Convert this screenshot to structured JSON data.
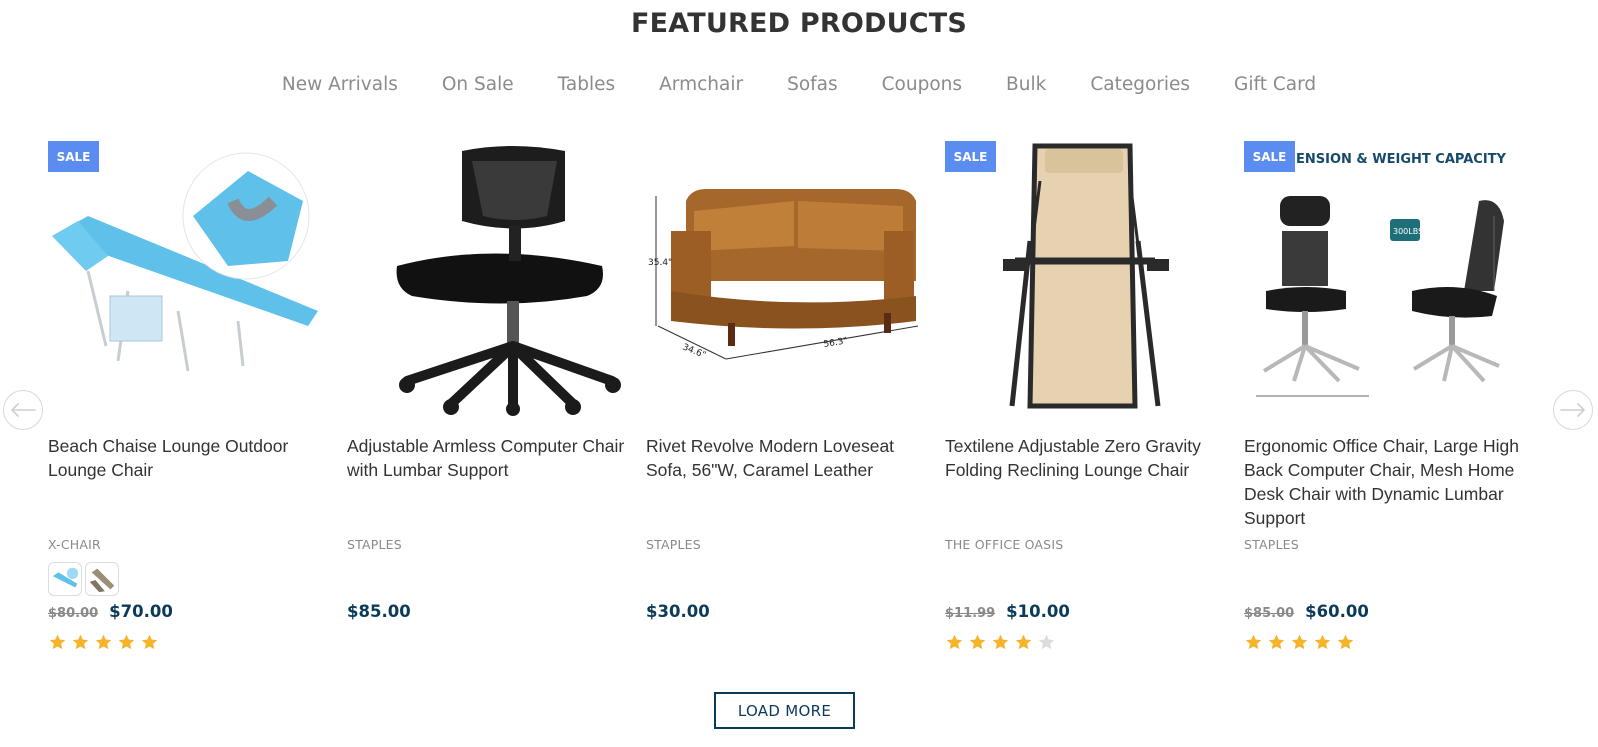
{
  "section_title": "FEATURED PRODUCTS",
  "tabs": [
    "New Arrivals",
    "On Sale",
    "Tables",
    "Armchair",
    "Sofas",
    "Coupons",
    "Bulk",
    "Categories",
    "Gift Card"
  ],
  "badge_label": "SALE",
  "products": [
    {
      "name": "Beach Chaise Lounge Outdoor Lounge Chair",
      "vendor": "X-CHAIR",
      "sale": true,
      "old_price": "$80.00",
      "price": "$70.00",
      "rating": 5,
      "swatches": [
        "light-blue",
        "tan"
      ]
    },
    {
      "name": "Adjustable Armless Computer Chair with Lumbar Support",
      "vendor": "STAPLES",
      "sale": false,
      "old_price": "",
      "price": "$85.00"
    },
    {
      "name": "Rivet Revolve Modern Loveseat Sofa, 56\"W, Caramel Leather",
      "vendor": "STAPLES",
      "sale": false,
      "old_price": "",
      "price": "$30.00",
      "image_labels": [
        "35.4\"",
        "34.6\"",
        "56.3\""
      ]
    },
    {
      "name": "Textilene Adjustable Zero Gravity Folding Reclining Lounge Chair",
      "vendor": "THE OFFICE OASIS",
      "sale": true,
      "old_price": "$11.99",
      "price": "$10.00",
      "rating": 4
    },
    {
      "name": "Ergonomic Office Chair, Large High Back Computer Chair, Mesh Home Desk Chair with Dynamic Lumbar Support",
      "vendor": "STAPLES",
      "sale": true,
      "old_price": "$85.00",
      "price": "$60.00",
      "rating": 5,
      "image_banner": "ENSION & WEIGHT CAPACITY",
      "image_tag": "300LBS"
    }
  ],
  "load_more_label": "LOAD MORE",
  "colors": {
    "sale_badge": "#5b8cf0",
    "price": "#0b3a5a",
    "star_filled": "#f6b42b",
    "star_empty": "#dcdcdc"
  },
  "icons": {
    "prev": "arrow-left-icon",
    "next": "arrow-right-icon",
    "star": "star-icon"
  }
}
